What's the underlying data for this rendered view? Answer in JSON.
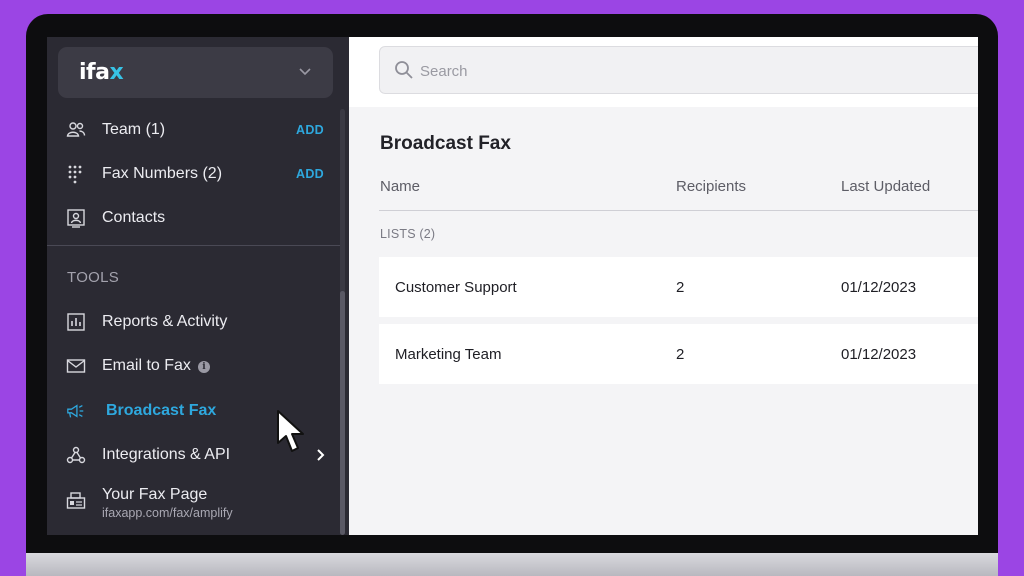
{
  "brand": {
    "logo_main": "ifa",
    "logo_accent": "x"
  },
  "sidebar": {
    "top_items": [
      {
        "label": "Team (1)",
        "action": "ADD",
        "icon": "team-icon"
      },
      {
        "label": "Fax Numbers (2)",
        "action": "ADD",
        "icon": "dialpad-icon"
      },
      {
        "label": "Contacts",
        "icon": "contacts-icon"
      }
    ],
    "section_title": "TOOLS",
    "tools": [
      {
        "label": "Reports & Activity",
        "icon": "chart-icon"
      },
      {
        "label": "Email to Fax",
        "icon": "envelope-icon",
        "info": "i"
      },
      {
        "label": "Broadcast Fax",
        "icon": "megaphone-icon",
        "active": true
      },
      {
        "label": "Integrations & API",
        "icon": "webhook-icon"
      },
      {
        "label": "Your Fax Page",
        "sub": "ifaxapp.com/fax/amplify",
        "icon": "fax-machine-icon"
      }
    ]
  },
  "search": {
    "placeholder": "Search"
  },
  "main": {
    "title": "Broadcast Fax",
    "columns": [
      "Name",
      "Recipients",
      "Last Updated"
    ],
    "group_label": "LISTS (2)",
    "rows": [
      {
        "name": "Customer Support",
        "recipients": "2",
        "updated": "01/12/2023"
      },
      {
        "name": "Marketing Team",
        "recipients": "2",
        "updated": "01/12/2023"
      }
    ]
  },
  "colors": {
    "accent": "#2ea8de",
    "sidebar_bg": "#2b2a33",
    "frame": "#9b45e4"
  }
}
